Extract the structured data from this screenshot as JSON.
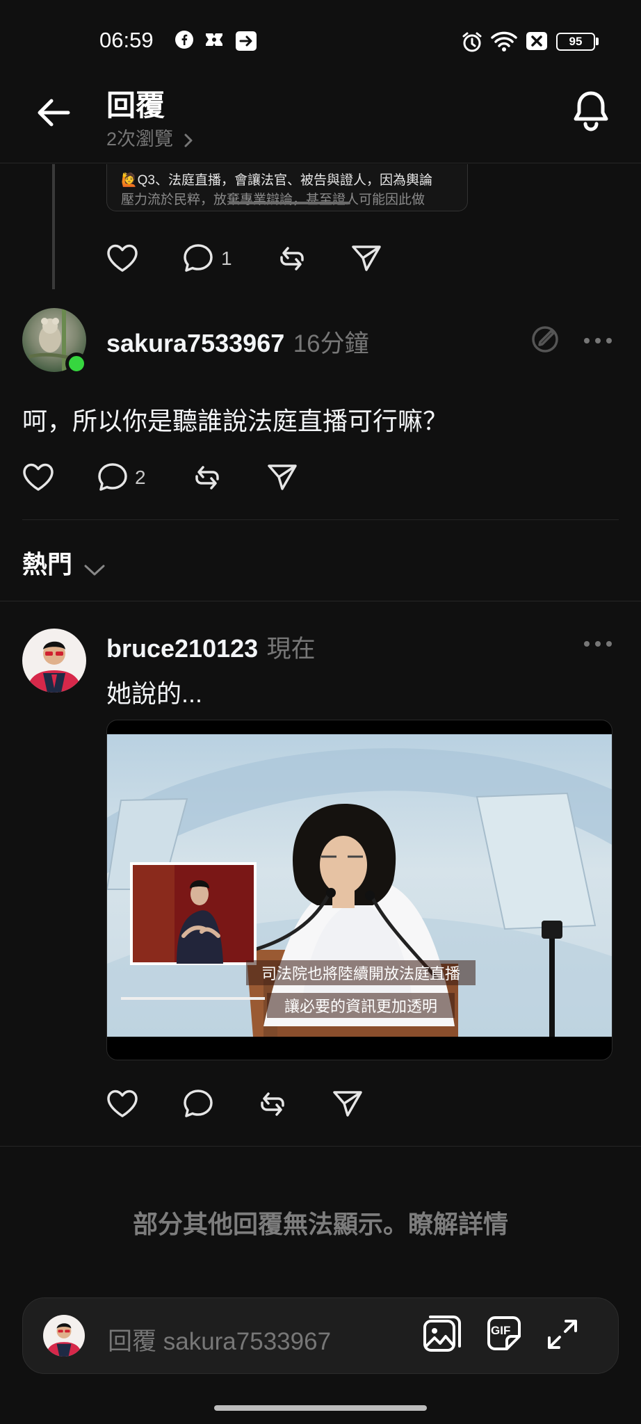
{
  "status_bar": {
    "time": "06:59",
    "battery": "95",
    "icons_left": [
      "facebook-icon",
      "messenger-icon",
      "arrow-box-icon"
    ],
    "icons_right": [
      "alarm-icon",
      "wifi-icon",
      "sim-icon",
      "battery-icon"
    ]
  },
  "header": {
    "title": "回覆",
    "views": "2次瀏覽",
    "back_icon": "back-arrow-icon",
    "bell_icon": "bell-icon"
  },
  "quoted_post": {
    "line1": "🙋Q3、法庭直播，會讓法官、被告與證人，因為輿論",
    "line2": "壓力流於民粹，放棄專業辯論，甚至證人可能因此做",
    "reply_count": "1"
  },
  "reply1": {
    "username": "sakura7533967",
    "time": "16分鐘",
    "text": "呵，所以你是聽誰說法庭直播可行嘛？",
    "reply_count": "2"
  },
  "sort": {
    "label": "熱門"
  },
  "reply2": {
    "username": "bruce210123",
    "time": "現在",
    "text": "她說的...",
    "caption_line1": "司法院也將陸續開放法庭直播",
    "caption_line2": "讓必要的資訊更加透明"
  },
  "footer_note": "部分其他回覆無法顯示。瞭解詳情",
  "composer": {
    "placeholder": "回覆 sakura7533967",
    "gif_label": "GIF"
  },
  "colors": {
    "background": "#101010",
    "text": "#f3f5f7",
    "muted": "#777777",
    "online": "#36d63f"
  }
}
